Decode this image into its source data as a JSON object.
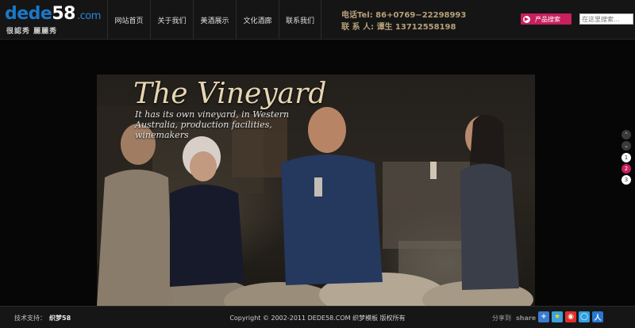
{
  "header": {
    "logo_main": "dede",
    "logo_number": "58",
    "logo_domain": ".com",
    "logo_sub": "很認秀 麗麗秀",
    "nav": [
      "网站首页",
      "关于我们",
      "美酒展示",
      "文化酒廊",
      "联系我们"
    ],
    "contact_phone": "电话Tel:  86+0769−22298993",
    "contact_person": "联 系 人:  谭生 13712558198",
    "search_button": "产品搜索",
    "search_placeholder": "在这里搜索..."
  },
  "banner": {
    "title": "The Vineyard",
    "subtitle": "It has its own vineyard, in Western Australia, production facilities, winemakers"
  },
  "slider": {
    "pages": [
      "1",
      "2",
      "3"
    ],
    "active_page": "2"
  },
  "footer": {
    "support_label": "技术支持：",
    "support_brand": "织梦58",
    "copyright": "Copyright © 2002-2011 DEDE58.COM 织梦模板 版权所有",
    "share_label": "分享到",
    "share_to": "share to",
    "share_icons": [
      "plus-share-icon",
      "star-share-icon",
      "weibo-share-icon",
      "tencent-share-icon",
      "renren-share-icon"
    ]
  },
  "colors": {
    "accent": "#c81f5e",
    "logo_blue": "#1b78c8",
    "contact_gold": "#b6a07a"
  }
}
